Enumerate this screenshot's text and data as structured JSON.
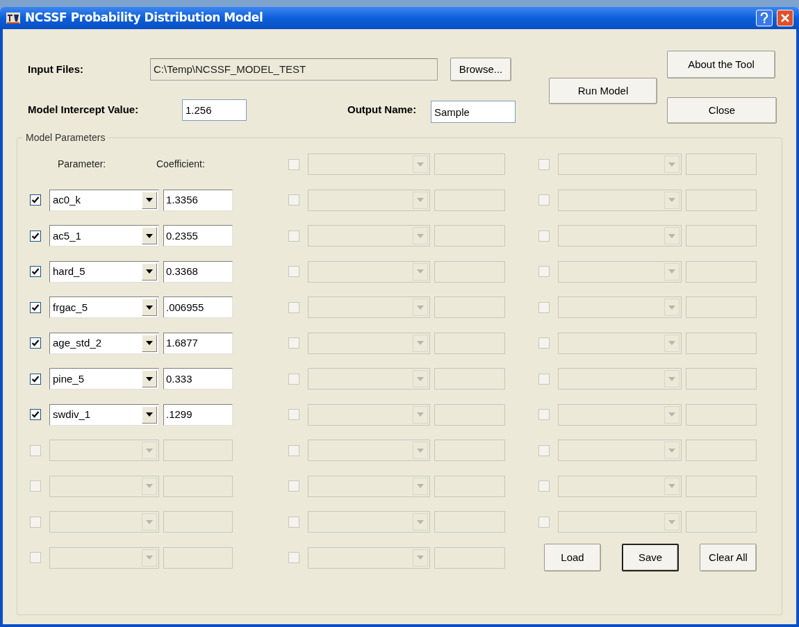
{
  "window": {
    "title": "NCSSF Probability Distribution Model"
  },
  "input_files": {
    "label": "Input Files:",
    "value": "C:\\Temp\\NCSSF_MODEL_TEST",
    "disabled": true
  },
  "browse_button": "Browse...",
  "intercept": {
    "label": "Model Intercept Value:",
    "value": "1.256"
  },
  "output_name": {
    "label": "Output Name:",
    "value": "Sample"
  },
  "buttons": {
    "run": "Run Model",
    "about": "About the Tool",
    "close": "Close"
  },
  "model_parameters": {
    "title": "Model Parameters",
    "parameter_header": "Parameter:",
    "coefficient_header": "Coefficient:",
    "columns": [
      {
        "slots": [
          {
            "checked": true,
            "disabled": false,
            "parameter": "ac0_k",
            "coefficient": "1.3356"
          },
          {
            "checked": true,
            "disabled": false,
            "parameter": "ac5_1",
            "coefficient": "0.2355"
          },
          {
            "checked": true,
            "disabled": false,
            "parameter": "hard_5",
            "coefficient": "0.3368"
          },
          {
            "checked": true,
            "disabled": false,
            "parameter": "frgac_5",
            "coefficient": ".006955"
          },
          {
            "checked": true,
            "disabled": false,
            "parameter": "age_std_2",
            "coefficient": "1.6877"
          },
          {
            "checked": true,
            "disabled": false,
            "parameter": "pine_5",
            "coefficient": "0.333"
          },
          {
            "checked": true,
            "disabled": false,
            "parameter": "swdiv_1",
            "coefficient": ".1299"
          },
          {
            "checked": false,
            "disabled": true
          },
          {
            "checked": false,
            "disabled": true
          },
          {
            "checked": false,
            "disabled": true
          },
          {
            "checked": false,
            "disabled": true
          }
        ]
      },
      {
        "slots": [
          {
            "checked": false,
            "disabled": true
          },
          {
            "checked": false,
            "disabled": true
          },
          {
            "checked": false,
            "disabled": true
          },
          {
            "checked": false,
            "disabled": true
          },
          {
            "checked": false,
            "disabled": true
          },
          {
            "checked": false,
            "disabled": true
          },
          {
            "checked": false,
            "disabled": true
          },
          {
            "checked": false,
            "disabled": true
          },
          {
            "checked": false,
            "disabled": true
          },
          {
            "checked": false,
            "disabled": true
          },
          {
            "checked": false,
            "disabled": true
          },
          {
            "checked": false,
            "disabled": true
          }
        ]
      },
      {
        "slots": [
          {
            "checked": false,
            "disabled": true
          },
          {
            "checked": false,
            "disabled": true
          },
          {
            "checked": false,
            "disabled": true
          },
          {
            "checked": false,
            "disabled": true
          },
          {
            "checked": false,
            "disabled": true
          },
          {
            "checked": false,
            "disabled": true
          },
          {
            "checked": false,
            "disabled": true
          },
          {
            "checked": false,
            "disabled": true
          },
          {
            "checked": false,
            "disabled": true
          },
          {
            "checked": false,
            "disabled": true
          },
          {
            "checked": false,
            "disabled": true
          }
        ]
      }
    ],
    "buttons": [
      {
        "label": "Load",
        "default": false
      },
      {
        "label": "Save",
        "default": true
      },
      {
        "label": "Clear All",
        "default": false
      }
    ]
  }
}
